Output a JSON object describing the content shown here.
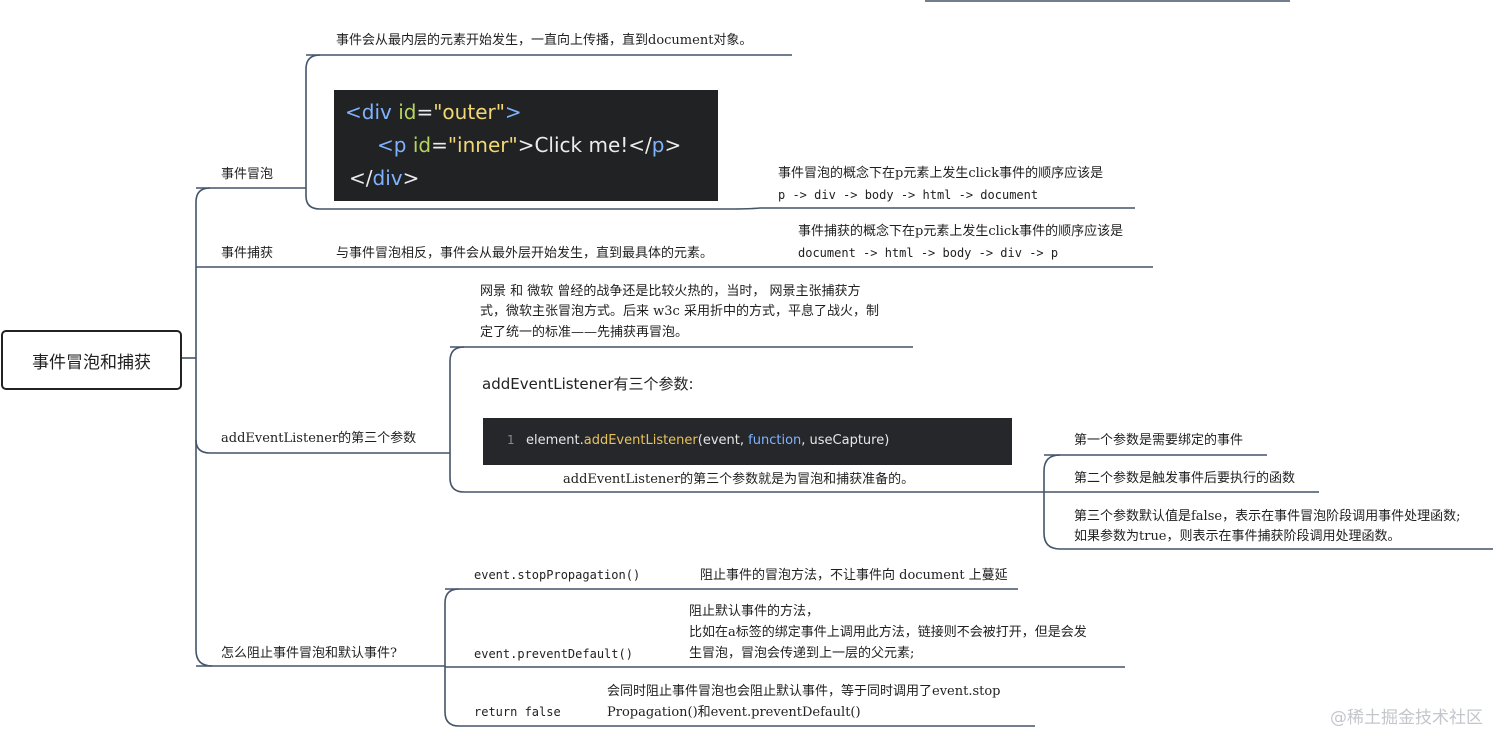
{
  "root": {
    "label": "事件冒泡和捕获"
  },
  "branches": {
    "bubbling": {
      "label": "事件冒泡",
      "description": "事件会从最内层的元素开始发生，一直向上传播，直到document对象。",
      "code_image": {
        "line1": {
          "tag_open": "<div ",
          "attr": "id",
          "eq": "=",
          "value": "\"outer\"",
          "close": ">"
        },
        "line2": {
          "tag_open": "<p ",
          "attr": "id",
          "eq": "=",
          "value": "\"inner\"",
          "text": ">Click me!</",
          "tag_close": "p",
          "end": ">"
        },
        "line3": {
          "open": "</",
          "tag": "div",
          "close": ">"
        }
      },
      "order_note": {
        "line1": "事件冒泡的概念下在p元素上发生click事件的顺序应该是",
        "line2": "p -> div -> body -> html -> document"
      }
    },
    "capturing": {
      "label": "事件捕获",
      "description": "与事件冒泡相反，事件会从最外层开始发生，直到最具体的元素。",
      "order_note": {
        "line1": "事件捕获的概念下在p元素上发生click事件的顺序应该是",
        "line2": "document -> html -> body -> div -> p"
      }
    },
    "third_param": {
      "label": "addEventListener的第三个参数",
      "history": {
        "line1": "网景 和 微软 曾经的战争还是比较火热的，当时， 网景主张捕获方",
        "line2": "式，微软主张冒泡方式。后来 w3c 采用折中的方式，平息了战火，制",
        "line3": "定了统一的标准——先捕获再冒泡。"
      },
      "panel": {
        "title": "addEventListener有三个参数:",
        "line_number": "1",
        "code": {
          "obj": "element.",
          "fn": "addEventListener",
          "args_a": "(event, ",
          "kw": "function",
          "args_b": ", useCapture)"
        }
      },
      "summary": "addEventListener的第三个参数就是为冒泡和捕获准备的。",
      "params": [
        {
          "text": "第一个参数是需要绑定的事件"
        },
        {
          "text": "第二个参数是触发事件后要执行的函数"
        },
        {
          "line1": "第三个参数默认值是false，表示在事件冒泡阶段调用事件处理函数;",
          "line2": "如果参数为true，则表示在事件捕获阶段调用处理函数。"
        }
      ]
    },
    "prevent": {
      "label": "怎么阻止事件冒泡和默认事件?",
      "items": [
        {
          "method": "event.stopPropagation()",
          "desc": "阻止事件的冒泡方法，不让事件向 document 上蔓延"
        },
        {
          "method": "event.preventDefault()",
          "desc_line1": "阻止默认事件的方法，",
          "desc_line2": "比如在a标签的绑定事件上调用此方法，链接则不会被打开，但是会发",
          "desc_line3": "生冒泡，冒泡会传递到上一层的父元素;"
        },
        {
          "method": "return false",
          "desc_line1": "会同时阻止事件冒泡也会阻止默认事件，等于同时调用了event.stop",
          "desc_line2": "Propagation()和event.preventDefault()"
        }
      ]
    }
  },
  "watermark": "@稀土掘金技术社区",
  "colors": {
    "line": "#44546a",
    "code_bg": "#212224",
    "code_bar_bg": "#26272b"
  }
}
